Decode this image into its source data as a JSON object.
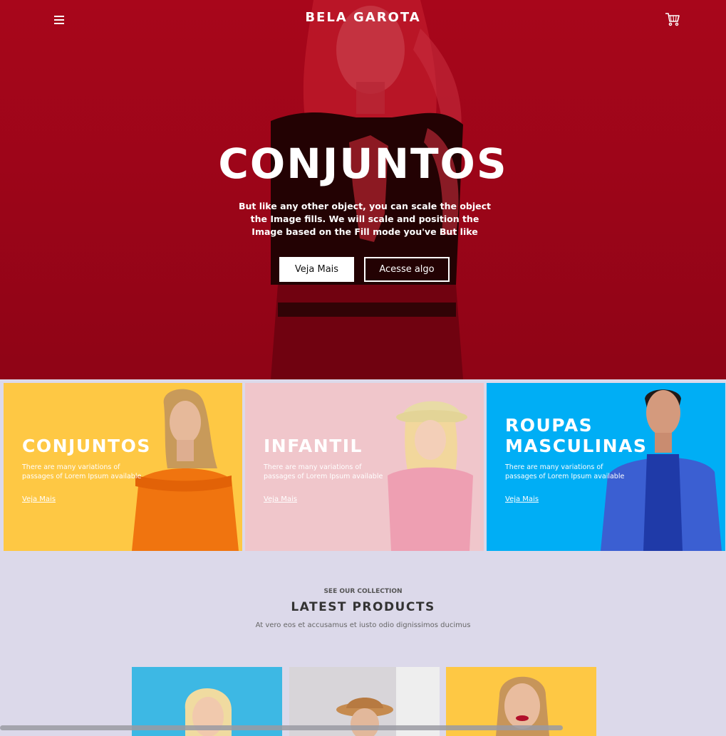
{
  "header": {
    "logo": "BELA GAROTA",
    "menu_icon": "hamburger-menu-icon",
    "cart_icon": "shopping-cart-icon"
  },
  "hero": {
    "title": "CONJUNTOS",
    "text": "But like any other object, you can scale the object the Image fills. We will scale and position the Image based on the Fill mode you've But like",
    "primary_button": "Veja Mais",
    "secondary_button": "Acesse algo",
    "background_color": "#9e0518"
  },
  "categories": [
    {
      "title": "CONJUNTOS",
      "text": "There are many variations of passages of Lorem Ipsum available",
      "link": "Veja Mais",
      "color": "#fec844"
    },
    {
      "title": "INFANTIL",
      "text": "There are many variations of passages of Lorem Ipsum available",
      "link": "Veja Mais",
      "color": "#f0c6cb"
    },
    {
      "title": "ROUPAS MASCULINAS",
      "text": "There are many variations of passages of Lorem Ipsum available",
      "link": "Veja Mais",
      "color": "#00aef5"
    }
  ],
  "collection": {
    "eyebrow": "SEE OUR COLLECTION",
    "title": "LATEST PRODUCTS",
    "subtitle": "At vero eos et accusamus et iusto odio dignissimos ducimus"
  },
  "products": [
    {
      "background_color": "#3db8e4"
    },
    {
      "background_color": "#c7c3c8"
    },
    {
      "background_color": "#fec844"
    }
  ],
  "page_background": "#dcd9ea"
}
